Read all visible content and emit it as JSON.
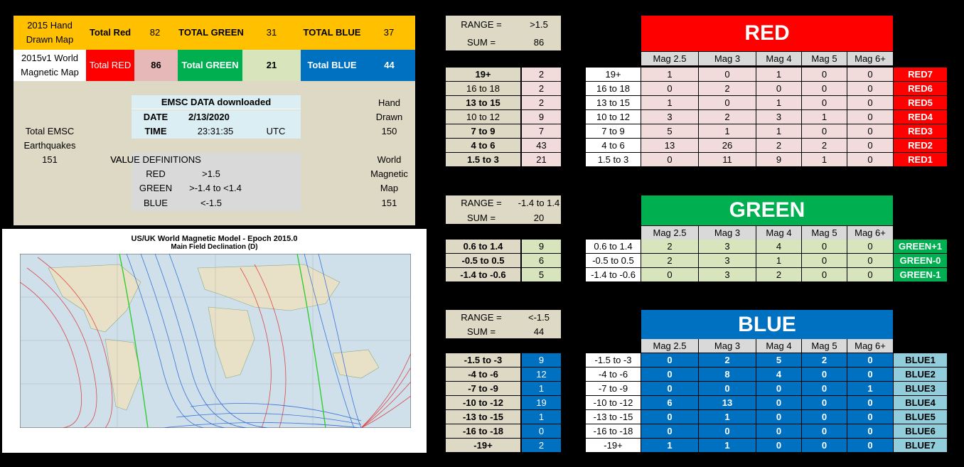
{
  "summary": {
    "hand_drawn_label": "2015 Hand Drawn Map",
    "total_red_label": "Total Red",
    "total_red_value": "82",
    "total_green_label": "TOTAL GREEN",
    "total_green_value": "31",
    "total_blue_label": "TOTAL BLUE",
    "total_blue_value": "37",
    "wmm_label": "2015v1 World Magnetic Map",
    "wmm_red_label": "Total RED",
    "wmm_red_value": "86",
    "wmm_green_label": "Total GREEN",
    "wmm_green_value": "21",
    "wmm_blue_label": "Total BLUE",
    "wmm_blue_value": "44",
    "emsc_title": "EMSC DATA downloaded",
    "date_label": "DATE",
    "date_value": "2/13/2020",
    "time_label": "TIME",
    "time_value": "23:31:35",
    "tz": "UTC",
    "total_emsc_line1": "Total EMSC",
    "total_emsc_line2": "Earthquakes",
    "total_emsc_value": "151",
    "value_defs_title": "VALUE DEFINITIONS",
    "defs": [
      {
        "name": "RED",
        "value": ">1.5"
      },
      {
        "name": "GREEN",
        "value": ">-1.4  to  <1.4"
      },
      {
        "name": "BLUE",
        "value": "<-1.5"
      }
    ],
    "right_hand": "Hand",
    "right_drawn": "Drawn",
    "right_hand_value": "150",
    "right_world": "World",
    "right_magnetic": "Magnetic",
    "right_map": "Map",
    "right_wmm_value": "151"
  },
  "map": {
    "title": "US/UK World Magnetic Model - Epoch 2015.0",
    "subtitle": "Main Field Declination (D)"
  },
  "red": {
    "range_label": "RANGE =",
    "range_value": ">1.5",
    "sum_label": "SUM =",
    "sum_value": "86",
    "title": "RED",
    "headers": [
      "Mag 2.5",
      "Mag 3",
      "Mag 4",
      "Mag 5",
      "Mag 6+"
    ],
    "rows": [
      {
        "range": "19+",
        "total": "2",
        "vals": [
          "1",
          "0",
          "1",
          "0",
          "0"
        ],
        "tag": "RED7",
        "bold": true
      },
      {
        "range": "16 to 18",
        "total": "2",
        "vals": [
          "0",
          "2",
          "0",
          "0",
          "0"
        ],
        "tag": "RED6",
        "bold": false
      },
      {
        "range": "13 to 15",
        "total": "2",
        "vals": [
          "1",
          "0",
          "1",
          "0",
          "0"
        ],
        "tag": "RED5",
        "bold": true
      },
      {
        "range": "10 to 12",
        "total": "9",
        "vals": [
          "3",
          "2",
          "3",
          "1",
          "0"
        ],
        "tag": "RED4",
        "bold": false
      },
      {
        "range": "7 to 9",
        "total": "7",
        "vals": [
          "5",
          "1",
          "1",
          "0",
          "0"
        ],
        "tag": "RED3",
        "bold": true
      },
      {
        "range": "4 to 6",
        "total": "43",
        "vals": [
          "13",
          "26",
          "2",
          "2",
          "0"
        ],
        "tag": "RED2",
        "bold": true
      },
      {
        "range": "1.5 to 3",
        "total": "21",
        "vals": [
          "0",
          "11",
          "9",
          "1",
          "0"
        ],
        "tag": "RED1",
        "bold": true
      }
    ]
  },
  "green": {
    "range_label": "RANGE =",
    "range_value": "-1.4 to 1.4",
    "sum_label": "SUM =",
    "sum_value": "20",
    "title": "GREEN",
    "headers": [
      "Mag 2.5",
      "Mag 3",
      "Mag 4",
      "Mag 5",
      "Mag 6+"
    ],
    "rows": [
      {
        "range": "0.6 to 1.4",
        "total": "9",
        "vals": [
          "2",
          "3",
          "4",
          "0",
          "0"
        ],
        "tag": "GREEN+1"
      },
      {
        "range": "-0.5 to 0.5",
        "total": "6",
        "vals": [
          "2",
          "3",
          "1",
          "0",
          "0"
        ],
        "tag": "GREEN-0"
      },
      {
        "range": "-1.4 to -0.6",
        "total": "5",
        "vals": [
          "0",
          "3",
          "2",
          "0",
          "0"
        ],
        "tag": "GREEN-1"
      }
    ]
  },
  "blue": {
    "range_label": "RANGE =",
    "range_value": "<-1.5",
    "sum_label": "SUM =",
    "sum_value": "44",
    "title": "BLUE",
    "headers": [
      "Mag 2.5",
      "Mag 3",
      "Mag 4",
      "Mag 5",
      "Mag 6+"
    ],
    "rows": [
      {
        "range": "-1.5 to -3",
        "total": "9",
        "vals": [
          "0",
          "2",
          "5",
          "2",
          "0"
        ],
        "tag": "BLUE1"
      },
      {
        "range": "-4 to -6",
        "total": "12",
        "vals": [
          "0",
          "8",
          "4",
          "0",
          "0"
        ],
        "tag": "BLUE2"
      },
      {
        "range": "-7 to -9",
        "total": "1",
        "vals": [
          "0",
          "0",
          "0",
          "0",
          "1"
        ],
        "tag": "BLUE3"
      },
      {
        "range": "-10 to -12",
        "total": "19",
        "vals": [
          "6",
          "13",
          "0",
          "0",
          "0"
        ],
        "tag": "BLUE4"
      },
      {
        "range": "-13 to -15",
        "total": "1",
        "vals": [
          "0",
          "1",
          "0",
          "0",
          "0"
        ],
        "tag": "BLUE5"
      },
      {
        "range": "-16 to -18",
        "total": "0",
        "vals": [
          "0",
          "0",
          "0",
          "0",
          "0"
        ],
        "tag": "BLUE6"
      },
      {
        "range": "-19+",
        "total": "2",
        "vals": [
          "1",
          "1",
          "0",
          "0",
          "0"
        ],
        "tag": "BLUE7"
      }
    ]
  },
  "colors": {
    "red": "#ff0000",
    "green": "#00b050",
    "blue": "#0070c0",
    "orange": "#ffc000",
    "tan": "#ddd9c4"
  }
}
